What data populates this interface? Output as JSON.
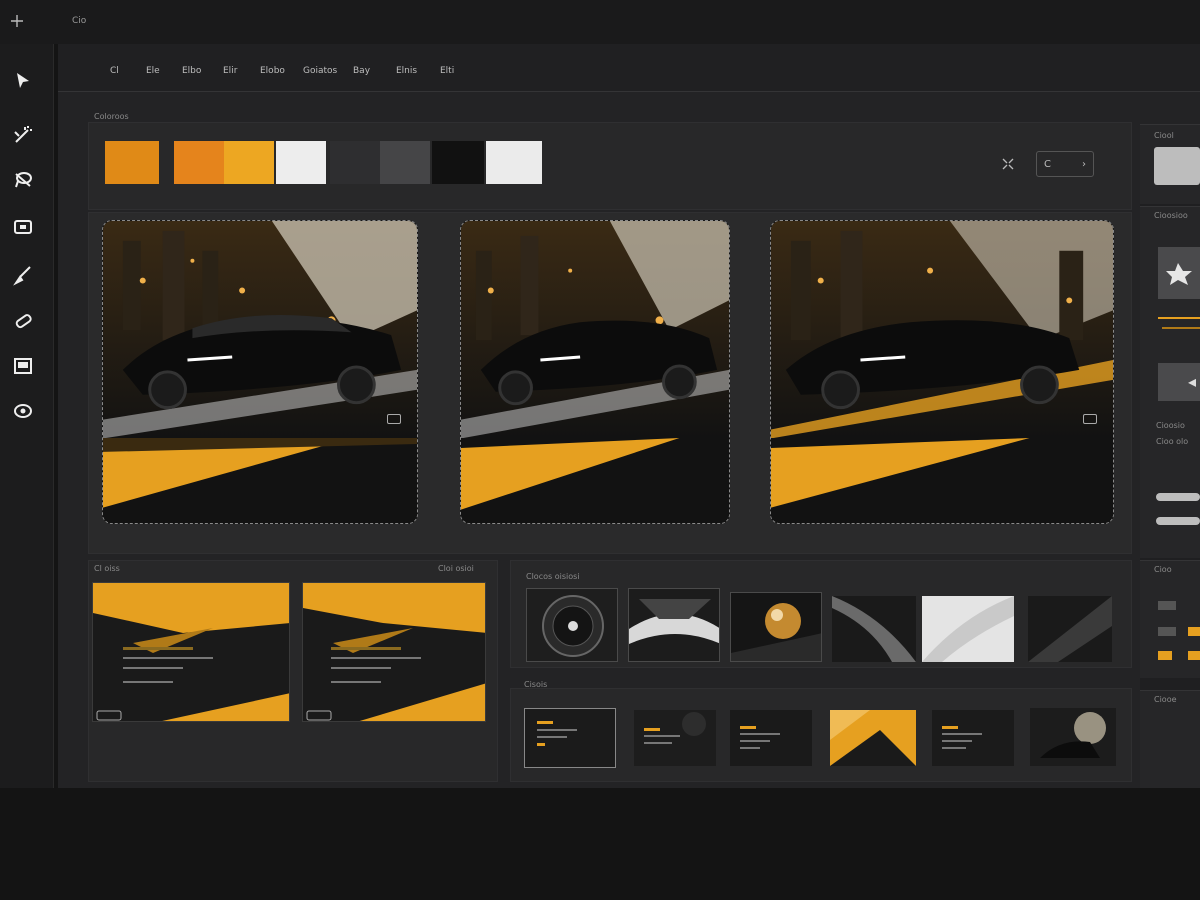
{
  "topbar": {
    "menu_icon": "crosshair-icon",
    "doc_label": "Cio"
  },
  "tools": [
    {
      "name": "select-arrow-icon"
    },
    {
      "name": "magic-wand-icon"
    },
    {
      "name": "lasso-icon"
    },
    {
      "name": "frame-icon"
    },
    {
      "name": "brush-icon"
    },
    {
      "name": "eraser-icon"
    },
    {
      "name": "image-icon"
    },
    {
      "name": "eye-icon"
    }
  ],
  "menu": [
    "Cl",
    "Ele",
    "Elbo",
    "Elir",
    "Elobo",
    "Goiatos",
    "Bay",
    "Elnis",
    "Elti"
  ],
  "palette": {
    "label": "Coloroos",
    "colors": [
      "#E08A17",
      "#E5841C",
      "#EDA722",
      "#EDEDED",
      "#2E2E30",
      "#454547",
      "#111111",
      "#EBEBEB"
    ],
    "fit_icon": "collapse-icon",
    "stepper_value": "C"
  },
  "sections": {
    "layouts": "Cl oiss",
    "layouts_right": "Cloi osioi",
    "textures": "Clocos oisiosi",
    "thumbnails": "Cisois"
  },
  "right_panel": {
    "color_label": "Ciool",
    "props_label": "Cioosioo",
    "text_a": "Cioosio",
    "text_b": "Cioo olo",
    "layers_label": "Cioo",
    "effects_label": "Ciooe",
    "swatch": "#BDBDBD"
  }
}
